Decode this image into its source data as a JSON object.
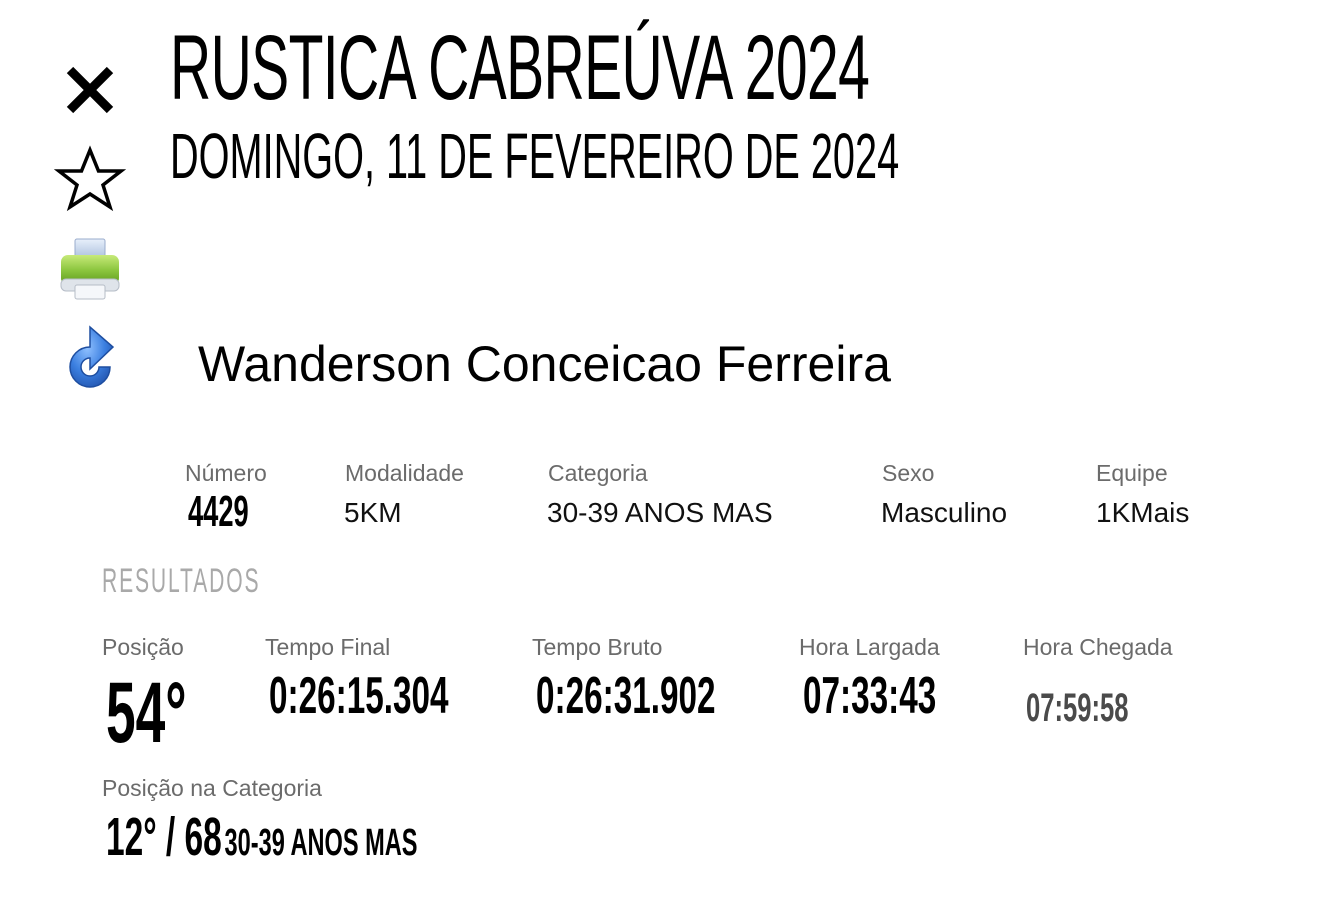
{
  "toolbar": {
    "close_icon": "close-icon",
    "star_icon": "star-icon",
    "print_icon": "printer-icon",
    "refresh_icon": "refresh-icon"
  },
  "header": {
    "title": "RUSTICA CABREÚVA 2024",
    "date": "DOMINGO, 11 DE FEVEREIRO DE 2024"
  },
  "athlete": {
    "name": "Wanderson Conceicao Ferreira"
  },
  "info": {
    "numero_label": "Número",
    "numero_value": "4429",
    "modalidade_label": "Modalidade",
    "modalidade_value": "5KM",
    "categoria_label": "Categoria",
    "categoria_value": "30-39 ANOS MAS",
    "sexo_label": "Sexo",
    "sexo_value": "Masculino",
    "equipe_label": "Equipe",
    "equipe_value": "1KMais"
  },
  "results": {
    "section_title": "RESULTADOS",
    "posicao_label": "Posição",
    "posicao_value": "54°",
    "tempo_final_label": "Tempo Final",
    "tempo_final_value": "0:26:15.304",
    "tempo_bruto_label": "Tempo Bruto",
    "tempo_bruto_value": "0:26:31.902",
    "hora_largada_label": "Hora Largada",
    "hora_largada_value": "07:33:43",
    "hora_chegada_label": "Hora Chegada",
    "hora_chegada_value": "07:59:58",
    "posicao_categoria_label": "Posição na Categoria",
    "posicao_categoria_value": "12° / 68",
    "posicao_categoria_name": "30-39 ANOS MAS"
  },
  "colors": {
    "label_gray": "#6b6b6b",
    "section_gray": "#a9a9a9",
    "printer_green": "#8cc63f",
    "refresh_blue": "#2f6fd0"
  }
}
